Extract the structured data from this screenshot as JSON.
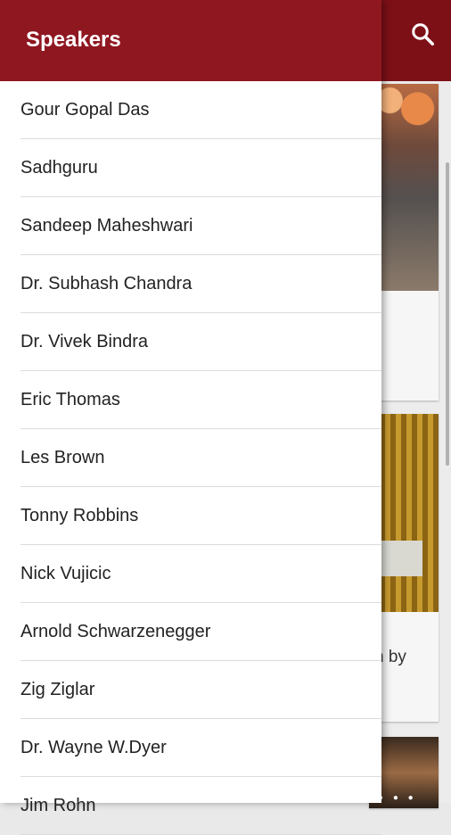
{
  "drawer": {
    "title": "Speakers",
    "speakers": [
      {
        "label": "Gour Gopal Das"
      },
      {
        "label": "Sadhguru"
      },
      {
        "label": "Sandeep Maheshwari"
      },
      {
        "label": "Dr. Subhash Chandra"
      },
      {
        "label": "Dr. Vivek Bindra"
      },
      {
        "label": "Eric Thomas"
      },
      {
        "label": "Les Brown"
      },
      {
        "label": "Tonny Robbins"
      },
      {
        "label": "Nick Vujicic"
      },
      {
        "label": "Arnold Schwarzenegger"
      },
      {
        "label": "Zig Ziglar"
      },
      {
        "label": "Dr. Wayne W.Dyer"
      },
      {
        "label": "Jim Rohn"
      }
    ]
  },
  "background": {
    "card2_text_fragment": "n by",
    "search_icon": "search-icon"
  },
  "colors": {
    "drawer_header": "#8f1720",
    "app_bar": "#7d1017"
  }
}
